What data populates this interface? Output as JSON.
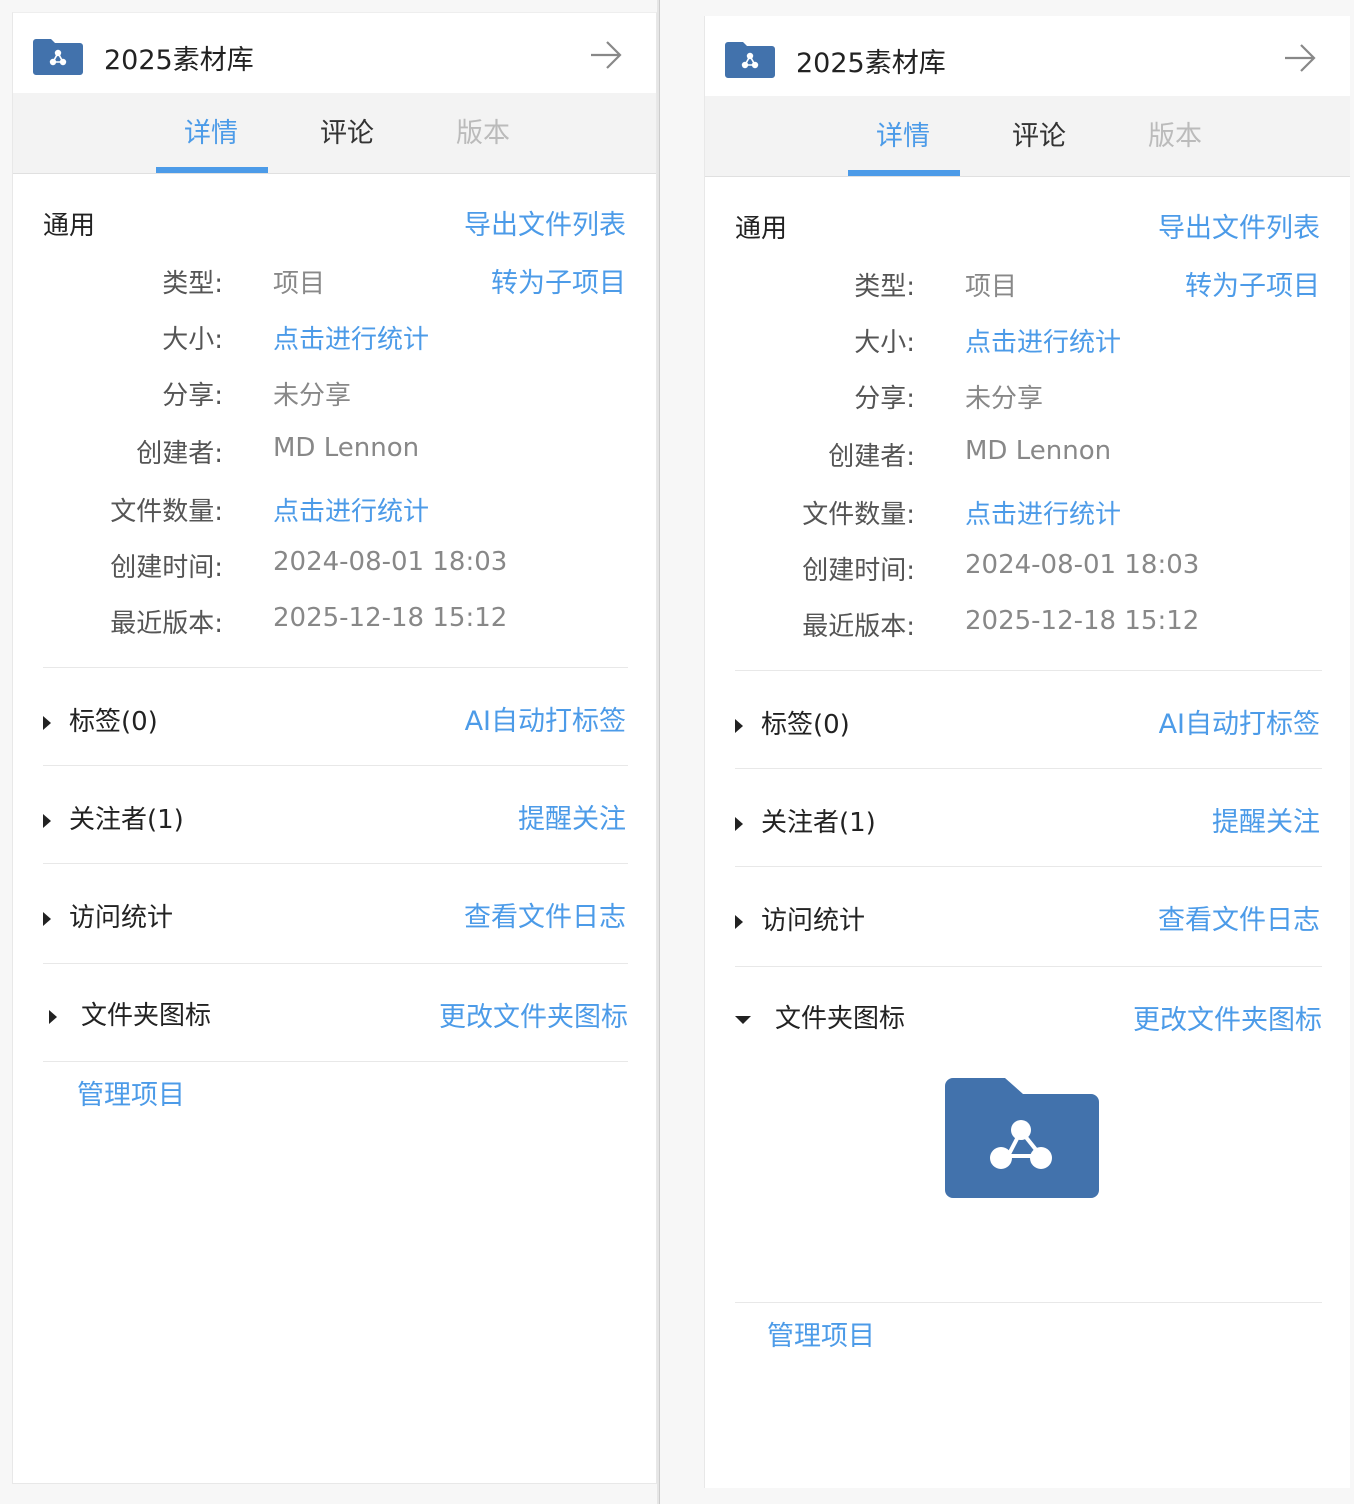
{
  "folder_title": "2025素材库",
  "tabs": [
    {
      "label": "详情"
    },
    {
      "label": "评论"
    },
    {
      "label": "版本"
    }
  ],
  "general": {
    "title": "通用",
    "export_link": "导出文件列表",
    "convert_link": "转为子项目",
    "fields": {
      "type_label": "类型:",
      "type_value": "项目",
      "size_label": "大小:",
      "size_value": "点击进行统计",
      "share_label": "分享:",
      "share_value": "未分享",
      "creator_label": "创建者:",
      "creator_value": "MD Lennon",
      "count_label": "文件数量:",
      "count_value": "点击进行统计",
      "created_label": "创建时间:",
      "created_value": "2024-08-01 18:03",
      "latest_label": "最近版本:",
      "latest_value": "2025-12-18 15:12"
    }
  },
  "sections": {
    "tags": {
      "label": "标签(0)",
      "action": "AI自动打标签"
    },
    "followers": {
      "label": "关注者(1)",
      "action": "提醒关注"
    },
    "visits": {
      "label": "访问统计",
      "action": "查看文件日志"
    },
    "folder_icon": {
      "label": "文件夹图标",
      "action": "更改文件夹图标"
    }
  },
  "manage_link": "管理项目",
  "colors": {
    "accent": "#4c9be8",
    "folder_blue": "#4272ac",
    "tab_bg": "#f3f3f3"
  },
  "icons": {
    "folder": "folder-share-icon",
    "arrow": "arrow-right-icon",
    "collapsed": "caret-right-icon",
    "expanded": "caret-down-icon"
  }
}
